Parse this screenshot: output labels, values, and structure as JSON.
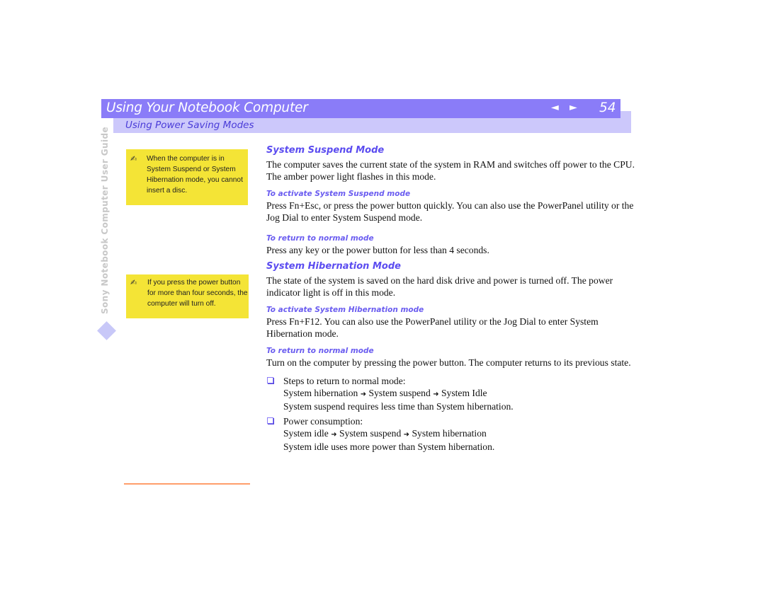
{
  "header": {
    "title": "Using Your Notebook Computer",
    "prev_icon": "◄",
    "next_icon": "►",
    "page_number": "54",
    "subtitle": "Using Power Saving Modes"
  },
  "sidebar": {
    "vertical_label": "Sony Notebook Computer User Guide"
  },
  "notes": [
    {
      "icon": "✍",
      "text": "When the computer is in System Suspend or System Hibernation mode, you cannot insert a disc."
    },
    {
      "icon": "✍",
      "text": "If you press the power button for more than four seconds, the computer will turn off."
    }
  ],
  "colors": {
    "header_bar": "#8a7cf8",
    "sub_bar": "#ccc8fb",
    "heading": "#5b4cf0",
    "note_bg": "#f4e436",
    "footer_rule": "#ff9e6b"
  },
  "content": {
    "suspend": {
      "heading": "System Suspend Mode",
      "body": "The computer saves the current state of the system in RAM and switches off power to the CPU. The amber power light flashes in this mode.",
      "activate_heading": "To activate System Suspend mode",
      "activate_body": "Press Fn+Esc, or press the power button quickly. You can also use the PowerPanel utility or the Jog Dial to enter System Suspend mode.",
      "return_heading": "To return to normal mode",
      "return_body": "Press any key or the power button for less than 4 seconds."
    },
    "hibernation": {
      "heading": "System Hibernation Mode",
      "body": "The state of the system is saved on the hard disk drive and power is turned off. The power indicator light is off in this mode.",
      "activate_heading": "To activate System Hibernation mode",
      "activate_body": "Press Fn+F12. You can also use the PowerPanel utility or the Jog Dial to enter System Hibernation mode.",
      "return_heading": "To return to normal mode",
      "return_body": "Turn on the computer by pressing the power button. The computer returns to its previous state."
    },
    "bullets": [
      {
        "title": "Steps to return to normal mode:",
        "seq": [
          "System hibernation",
          "System suspend",
          "System Idle"
        ],
        "note": "System suspend requires less time than System hibernation."
      },
      {
        "title": "Power consumption:",
        "seq": [
          "System idle",
          "System suspend",
          "System hibernation"
        ],
        "note": "System idle uses more power than System hibernation."
      }
    ],
    "arrow_glyph": "➜"
  }
}
